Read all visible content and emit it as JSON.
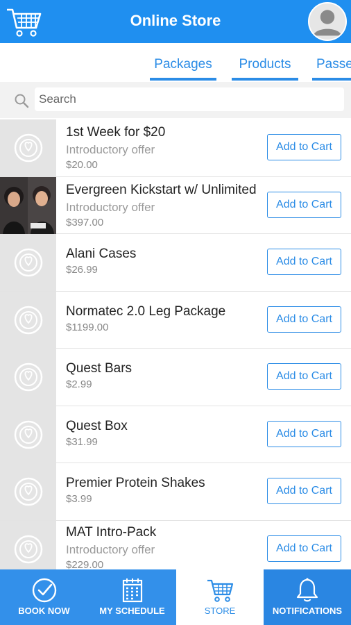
{
  "header": {
    "title": "Online Store"
  },
  "tabs": [
    {
      "label": "Packages"
    },
    {
      "label": "Products"
    },
    {
      "label": "Passes"
    }
  ],
  "search": {
    "placeholder": "Search"
  },
  "button_label": "Add to Cart",
  "items": [
    {
      "name": "1st Week for $20",
      "subtitle": "Introductory offer",
      "price": "$20.00"
    },
    {
      "name": "Evergreen Kickstart w/ Unlimited",
      "subtitle": "Introductory offer",
      "price": "$397.00"
    },
    {
      "name": "Alani Cases",
      "subtitle": "",
      "price": "$26.99"
    },
    {
      "name": "Normatec 2.0 Leg Package",
      "subtitle": "",
      "price": "$1199.00"
    },
    {
      "name": "Quest Bars",
      "subtitle": "",
      "price": "$2.99"
    },
    {
      "name": "Quest Box",
      "subtitle": "",
      "price": "$31.99"
    },
    {
      "name": "Premier Protein Shakes",
      "subtitle": "",
      "price": "$3.99"
    },
    {
      "name": "MAT Intro-Pack",
      "subtitle": "Introductory offer",
      "price": "$229.00"
    }
  ],
  "bottom_nav": [
    {
      "label": "BOOK NOW"
    },
    {
      "label": "MY SCHEDULE"
    },
    {
      "label": "STORE"
    },
    {
      "label": "NOTIFICATIONS"
    }
  ],
  "colors": {
    "primary": "#1f8ff0",
    "nav": "#3390ea",
    "accent": "#2b8ce6"
  },
  "icons": [
    "shopping-cart-icon",
    "avatar-icon",
    "search-icon",
    "placeholder-logo-icon",
    "checkmark-circle-icon",
    "calendar-icon",
    "bell-icon"
  ]
}
